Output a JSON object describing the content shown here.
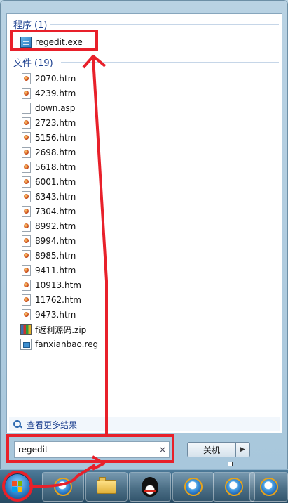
{
  "start_menu": {
    "programs_group": {
      "title": "程序",
      "count": "(1)"
    },
    "program_result": {
      "label": "regedit.exe",
      "icon": "regedit-icon"
    },
    "files_group": {
      "title": "文件",
      "count": "(19)"
    },
    "files": [
      {
        "label": "2070.htm",
        "icon": "htm-file-icon"
      },
      {
        "label": "4239.htm",
        "icon": "htm-file-icon"
      },
      {
        "label": "down.asp",
        "icon": "blank-file-icon"
      },
      {
        "label": "2723.htm",
        "icon": "htm-file-icon"
      },
      {
        "label": "5156.htm",
        "icon": "htm-file-icon"
      },
      {
        "label": "2698.htm",
        "icon": "htm-file-icon"
      },
      {
        "label": "5618.htm",
        "icon": "htm-file-icon"
      },
      {
        "label": "6001.htm",
        "icon": "htm-file-icon"
      },
      {
        "label": "6343.htm",
        "icon": "htm-file-icon"
      },
      {
        "label": "7304.htm",
        "icon": "htm-file-icon"
      },
      {
        "label": "8992.htm",
        "icon": "htm-file-icon"
      },
      {
        "label": "8994.htm",
        "icon": "htm-file-icon"
      },
      {
        "label": "8985.htm",
        "icon": "htm-file-icon"
      },
      {
        "label": "9411.htm",
        "icon": "htm-file-icon"
      },
      {
        "label": "10913.htm",
        "icon": "htm-file-icon"
      },
      {
        "label": "11762.htm",
        "icon": "htm-file-icon"
      },
      {
        "label": "9473.htm",
        "icon": "htm-file-icon"
      },
      {
        "label": "f返利源码.zip",
        "icon": "zip-archive-icon"
      },
      {
        "label": "fanxianbao.reg",
        "icon": "reg-file-icon"
      }
    ],
    "see_more": {
      "label": "查看更多结果",
      "icon": "search-icon"
    },
    "search": {
      "value": "regedit",
      "clear_symbol": "×"
    },
    "shutdown": {
      "label": "关机",
      "arrow_symbol": "▶"
    }
  },
  "taskbar": {
    "items": [
      {
        "name": "internet-explorer",
        "icon": "ie-icon"
      },
      {
        "name": "windows-explorer",
        "icon": "folder-icon"
      },
      {
        "name": "qq",
        "icon": "qq-penguin-icon"
      },
      {
        "name": "internet-explorer-2",
        "icon": "ie-icon"
      },
      {
        "name": "internet-explorer-3",
        "icon": "ie-icon"
      },
      {
        "name": "internet-explorer-4",
        "icon": "ie-icon"
      }
    ]
  },
  "colors": {
    "annotation_red": "#e8202a",
    "group_title": "#1b3f8f",
    "taskbar": "#2f5873"
  }
}
